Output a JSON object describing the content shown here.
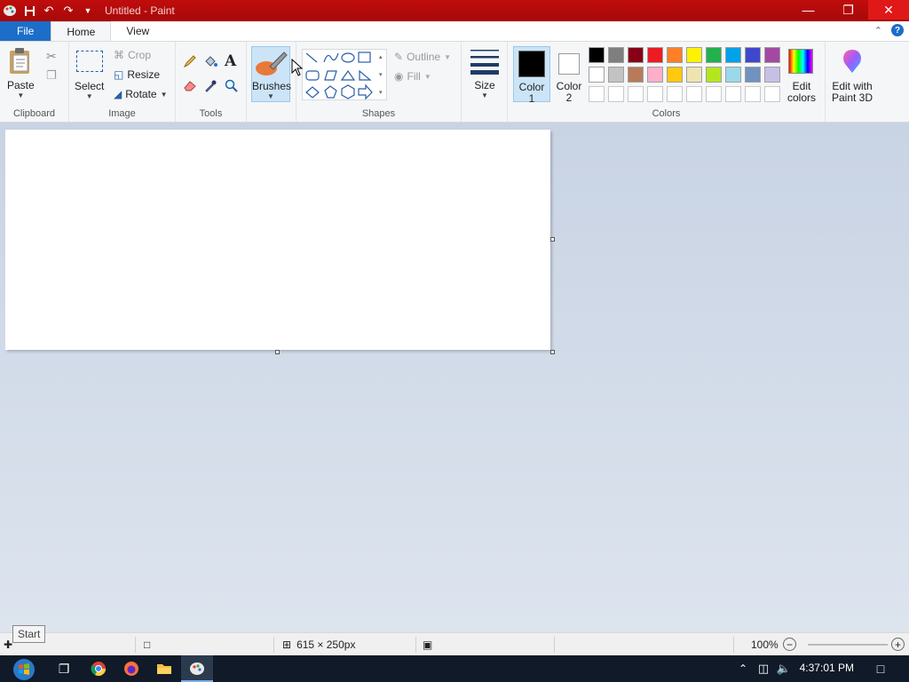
{
  "window": {
    "title": "Untitled - Paint",
    "minimize_icon": "minimize-icon",
    "maximize_icon": "restore-icon",
    "close_icon": "close-icon"
  },
  "menu": {
    "file": "File",
    "home": "Home",
    "view": "View",
    "help": "?"
  },
  "ribbon": {
    "clipboard": {
      "label": "Clipboard",
      "paste": "Paste"
    },
    "image": {
      "label": "Image",
      "select": "Select",
      "crop": "Crop",
      "resize": "Resize",
      "rotate": "Rotate"
    },
    "tools": {
      "label": "Tools"
    },
    "brushes": {
      "label": "Brushes"
    },
    "shapes": {
      "label": "Shapes",
      "outline": "Outline",
      "fill": "Fill"
    },
    "size": {
      "label": "Size"
    },
    "colors": {
      "label": "Colors",
      "color1_a": "Color",
      "color1_b": "1",
      "color2_a": "Color",
      "color2_b": "2",
      "edit_a": "Edit",
      "edit_b": "colors",
      "paint3d_a": "Edit with",
      "paint3d_b": "Paint 3D",
      "color1_value": "#000000",
      "color2_value": "#ffffff",
      "palette_row1": [
        "#000000",
        "#7f7f7f",
        "#880015",
        "#ed1c24",
        "#ff7f27",
        "#fff200",
        "#22b14c",
        "#00a2e8",
        "#3f48cc",
        "#a349a4"
      ],
      "palette_row2": [
        "#ffffff",
        "#c3c3c3",
        "#b97a57",
        "#ffaec9",
        "#ffc90e",
        "#efe4b0",
        "#b5e61d",
        "#99d9ea",
        "#7092be",
        "#c8bfe7"
      ]
    }
  },
  "status": {
    "tooltip": "Start",
    "canvas_size": "615 × 250px",
    "zoom": "100%"
  },
  "taskbar": {
    "clock": "4:37:01 PM"
  }
}
